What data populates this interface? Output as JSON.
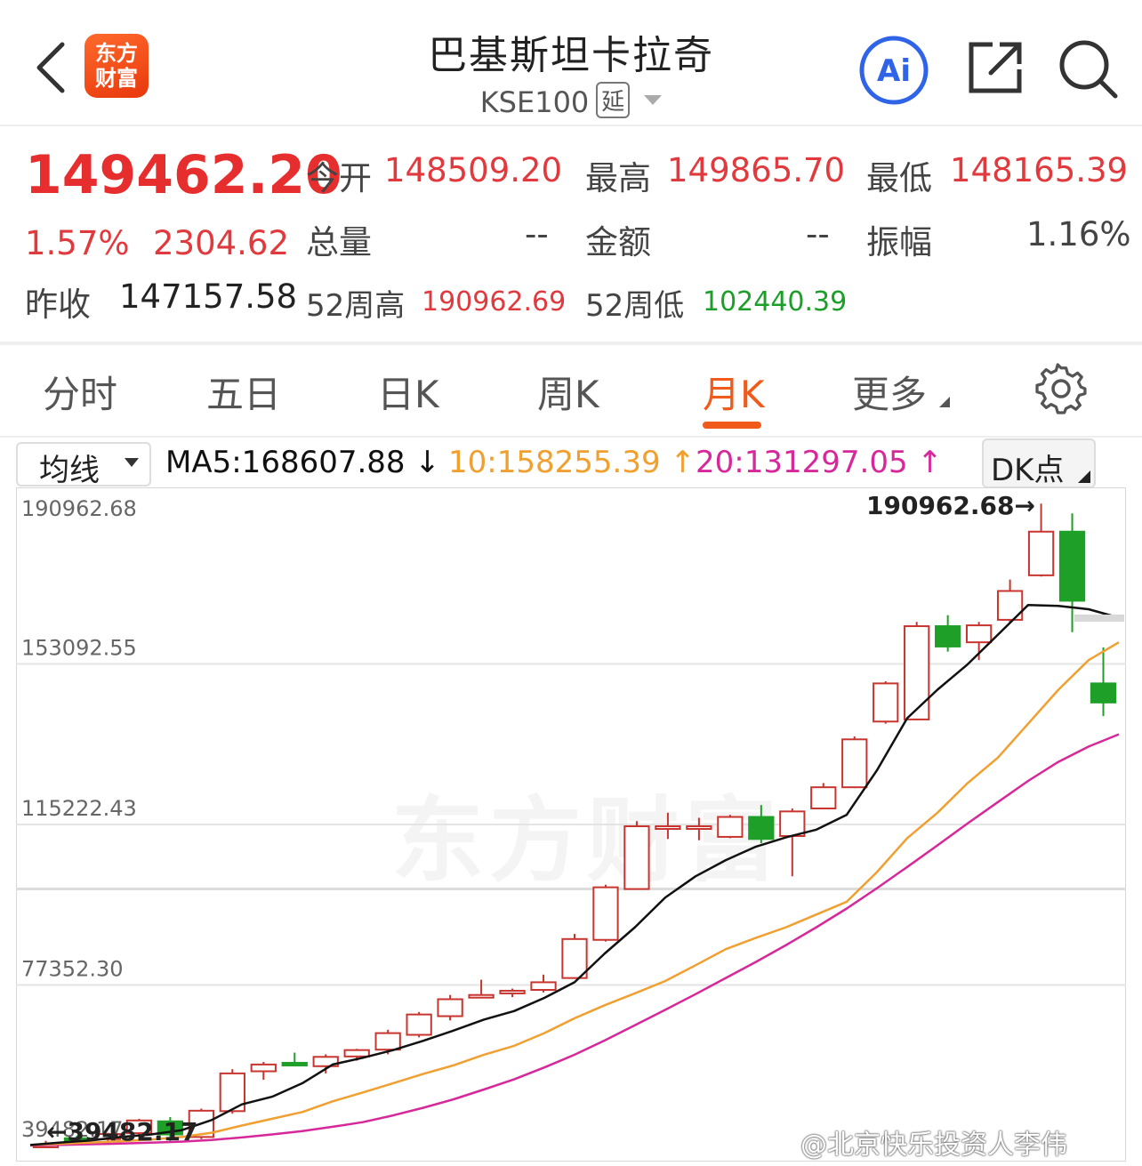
{
  "header": {
    "logo_line1": "东方",
    "logo_line2": "财富",
    "title": "巴基斯坦卡拉奇",
    "code": "KSE100",
    "delay_badge": "延",
    "icons": [
      "back-icon",
      "ai-icon",
      "share-icon",
      "search-icon"
    ],
    "ai_label": "Ai"
  },
  "quote": {
    "price": "149462.20",
    "change_pct": "1.57%",
    "change": "2304.62",
    "prev_close_label": "昨收",
    "prev_close": "147157.58",
    "open_label": "今开",
    "open": "148509.20",
    "high_label": "最高",
    "high": "149865.70",
    "low_label": "最低",
    "low": "148165.39",
    "volume_label": "总量",
    "volume": "--",
    "amount_label": "金额",
    "amount": "--",
    "amplitude_label": "振幅",
    "amplitude": "1.16%",
    "wk52_high_label": "52周高",
    "wk52_high": "190962.69",
    "wk52_low_label": "52周低",
    "wk52_low": "102440.39",
    "colors": {
      "up": "#e03a3e",
      "down": "#1c9f28"
    }
  },
  "tabs": [
    {
      "label": "分时"
    },
    {
      "label": "五日"
    },
    {
      "label": "日K"
    },
    {
      "label": "周K"
    },
    {
      "label": "月K",
      "active": true
    },
    {
      "label": "更多"
    }
  ],
  "ma_bar": {
    "select_label": "均线",
    "ma5": "MA5:168607.88 ↓",
    "ma10": "10:158255.39 ↑",
    "ma20": "20:131297.05 ↑",
    "dk_label": "DK点",
    "colors": {
      "ma5": "#111111",
      "ma10": "#f0a030",
      "ma20": "#d6289a"
    }
  },
  "chart_data": {
    "type": "candlestick",
    "y_ticks": [
      "190962.68",
      "153092.55",
      "115222.43",
      "77352.30",
      "39482.17"
    ],
    "ylim": [
      39482.17,
      190962.68
    ],
    "max_marker": "190962.68→",
    "min_marker": "←39482.17",
    "candles": [
      {
        "o": 39600,
        "h": 40600,
        "l": 39400,
        "c": 39700
      },
      {
        "o": 41200,
        "h": 41800,
        "l": 40500,
        "c": 41000
      },
      {
        "o": 41000,
        "h": 42500,
        "l": 40200,
        "c": 42200
      },
      {
        "o": 42400,
        "h": 45800,
        "l": 41500,
        "c": 45400
      },
      {
        "o": 45200,
        "h": 46200,
        "l": 40500,
        "c": 42100
      },
      {
        "o": 41500,
        "h": 48200,
        "l": 41000,
        "c": 47700
      },
      {
        "o": 47600,
        "h": 57500,
        "l": 47000,
        "c": 56500
      },
      {
        "o": 57000,
        "h": 59200,
        "l": 55000,
        "c": 58600
      },
      {
        "o": 59000,
        "h": 61400,
        "l": 58200,
        "c": 58400
      },
      {
        "o": 58200,
        "h": 61000,
        "l": 56500,
        "c": 60400
      },
      {
        "o": 60500,
        "h": 62300,
        "l": 59500,
        "c": 62000
      },
      {
        "o": 62100,
        "h": 66800,
        "l": 61000,
        "c": 66000
      },
      {
        "o": 65600,
        "h": 71000,
        "l": 65000,
        "c": 70400
      },
      {
        "o": 70000,
        "h": 75000,
        "l": 69000,
        "c": 74000
      },
      {
        "o": 75000,
        "h": 78600,
        "l": 74500,
        "c": 75000
      },
      {
        "o": 75400,
        "h": 76500,
        "l": 74500,
        "c": 76000
      },
      {
        "o": 76200,
        "h": 79800,
        "l": 75600,
        "c": 78000
      },
      {
        "o": 79000,
        "h": 89400,
        "l": 78800,
        "c": 88200
      },
      {
        "o": 88000,
        "h": 101000,
        "l": 87600,
        "c": 100400
      },
      {
        "o": 100000,
        "h": 116000,
        "l": 99800,
        "c": 114800
      },
      {
        "o": 114800,
        "h": 118000,
        "l": 111800,
        "c": 114800
      },
      {
        "o": 114800,
        "h": 116800,
        "l": 111500,
        "c": 114800
      },
      {
        "o": 112300,
        "h": 117500,
        "l": 112000,
        "c": 117000
      },
      {
        "o": 117000,
        "h": 119800,
        "l": 110800,
        "c": 111800
      },
      {
        "o": 112500,
        "h": 119000,
        "l": 103000,
        "c": 118300
      },
      {
        "o": 119000,
        "h": 125000,
        "l": 118800,
        "c": 124000
      },
      {
        "o": 124000,
        "h": 136000,
        "l": 123800,
        "c": 135300
      },
      {
        "o": 139500,
        "h": 149000,
        "l": 139000,
        "c": 148500
      },
      {
        "o": 140000,
        "h": 163000,
        "l": 139800,
        "c": 162000
      },
      {
        "o": 162000,
        "h": 164600,
        "l": 156000,
        "c": 157200
      },
      {
        "o": 158200,
        "h": 163000,
        "l": 154000,
        "c": 162200
      },
      {
        "o": 163500,
        "h": 173000,
        "l": 162800,
        "c": 170300
      },
      {
        "o": 174000,
        "h": 190900,
        "l": 173700,
        "c": 184300
      },
      {
        "o": 184300,
        "h": 188600,
        "l": 160600,
        "c": 168000
      },
      {
        "o": 148500,
        "h": 157000,
        "l": 140800,
        "c": 144000
      }
    ],
    "ma5": [
      39600,
      40200,
      40700,
      41500,
      42100,
      43100,
      45500,
      49200,
      51000,
      54200,
      58600,
      60200,
      62000,
      64200,
      66600,
      69200,
      71200,
      74300,
      78000,
      84800,
      91000,
      98000,
      103000,
      106800,
      110000,
      112200,
      114000,
      117500,
      128000,
      140300,
      147000,
      153000,
      160000,
      167000,
      166800,
      166000,
      164000
    ],
    "ma10": [
      39600,
      39900,
      40200,
      40500,
      40900,
      41500,
      42500,
      44200,
      45800,
      47400,
      49900,
      52000,
      54200,
      56400,
      58400,
      60900,
      63000,
      66000,
      69500,
      72600,
      75400,
      78300,
      82000,
      85800,
      88500,
      91000,
      94000,
      97000,
      104000,
      112000,
      118000,
      125000,
      131000,
      139000,
      147000,
      154000,
      158200
    ],
    "ma20": [
      39500,
      39650,
      39800,
      39950,
      40150,
      40400,
      40800,
      41400,
      42100,
      42900,
      43900,
      45000,
      46600,
      48400,
      50400,
      52700,
      55100,
      57900,
      60900,
      64300,
      67900,
      71500,
      75200,
      79000,
      82800,
      86800,
      91000,
      95400,
      100200,
      105200,
      110300,
      115500,
      120500,
      125500,
      130000,
      133600,
      136500
    ]
  },
  "watermark": {
    "logo_text": "东方财富",
    "weibo": "@北京快乐投资人李伟"
  }
}
